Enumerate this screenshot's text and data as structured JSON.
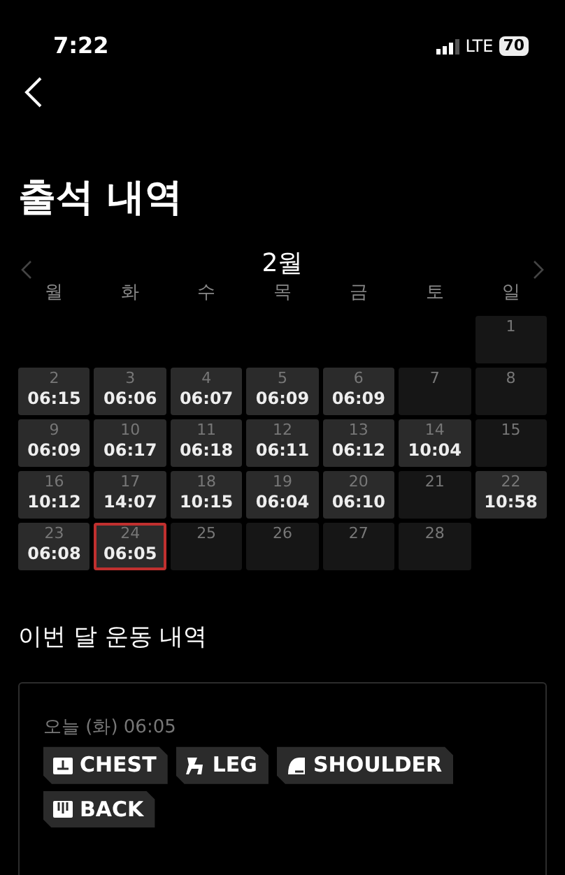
{
  "status_bar": {
    "time": "7:22",
    "network": "LTE",
    "battery": "70"
  },
  "title": "출석 내역",
  "calendar": {
    "month": "2월",
    "weekdays": [
      "월",
      "화",
      "수",
      "목",
      "금",
      "토",
      "일"
    ],
    "cells": [
      {
        "kind": "blank"
      },
      {
        "kind": "blank"
      },
      {
        "kind": "blank"
      },
      {
        "kind": "blank"
      },
      {
        "kind": "blank"
      },
      {
        "kind": "blank"
      },
      {
        "kind": "day",
        "day": "1",
        "selected": false
      },
      {
        "kind": "day",
        "day": "2",
        "time": "06:15",
        "selected": false
      },
      {
        "kind": "day",
        "day": "3",
        "time": "06:06",
        "selected": false
      },
      {
        "kind": "day",
        "day": "4",
        "time": "06:07",
        "selected": false
      },
      {
        "kind": "day",
        "day": "5",
        "time": "06:09",
        "selected": false
      },
      {
        "kind": "day",
        "day": "6",
        "time": "06:09",
        "selected": false
      },
      {
        "kind": "day",
        "day": "7",
        "selected": false
      },
      {
        "kind": "day",
        "day": "8",
        "selected": false
      },
      {
        "kind": "day",
        "day": "9",
        "time": "06:09",
        "selected": false
      },
      {
        "kind": "day",
        "day": "10",
        "time": "06:17",
        "selected": false
      },
      {
        "kind": "day",
        "day": "11",
        "time": "06:18",
        "selected": false
      },
      {
        "kind": "day",
        "day": "12",
        "time": "06:11",
        "selected": false
      },
      {
        "kind": "day",
        "day": "13",
        "time": "06:12",
        "selected": false
      },
      {
        "kind": "day",
        "day": "14",
        "time": "10:04",
        "selected": false
      },
      {
        "kind": "day",
        "day": "15",
        "selected": false
      },
      {
        "kind": "day",
        "day": "16",
        "time": "10:12",
        "selected": false
      },
      {
        "kind": "day",
        "day": "17",
        "time": "14:07",
        "selected": false
      },
      {
        "kind": "day",
        "day": "18",
        "time": "10:15",
        "selected": false
      },
      {
        "kind": "day",
        "day": "19",
        "time": "06:04",
        "selected": false
      },
      {
        "kind": "day",
        "day": "20",
        "time": "06:10",
        "selected": false
      },
      {
        "kind": "day",
        "day": "21",
        "selected": false
      },
      {
        "kind": "day",
        "day": "22",
        "time": "10:58",
        "selected": false
      },
      {
        "kind": "day",
        "day": "23",
        "time": "06:08",
        "selected": false
      },
      {
        "kind": "day",
        "day": "24",
        "time": "06:05",
        "selected": true
      },
      {
        "kind": "day",
        "day": "25",
        "selected": false
      },
      {
        "kind": "day",
        "day": "26",
        "selected": false
      },
      {
        "kind": "day",
        "day": "27",
        "selected": false
      },
      {
        "kind": "day",
        "day": "28",
        "selected": false
      }
    ]
  },
  "history": {
    "heading": "이번 달 운동 내역",
    "date": "오늘 (화) 06:05",
    "tags": [
      {
        "kind": "chest",
        "label": "CHEST"
      },
      {
        "kind": "leg",
        "label": "LEG"
      },
      {
        "kind": "shoulder",
        "label": "SHOULDER"
      },
      {
        "kind": "back",
        "label": "BACK"
      }
    ]
  }
}
